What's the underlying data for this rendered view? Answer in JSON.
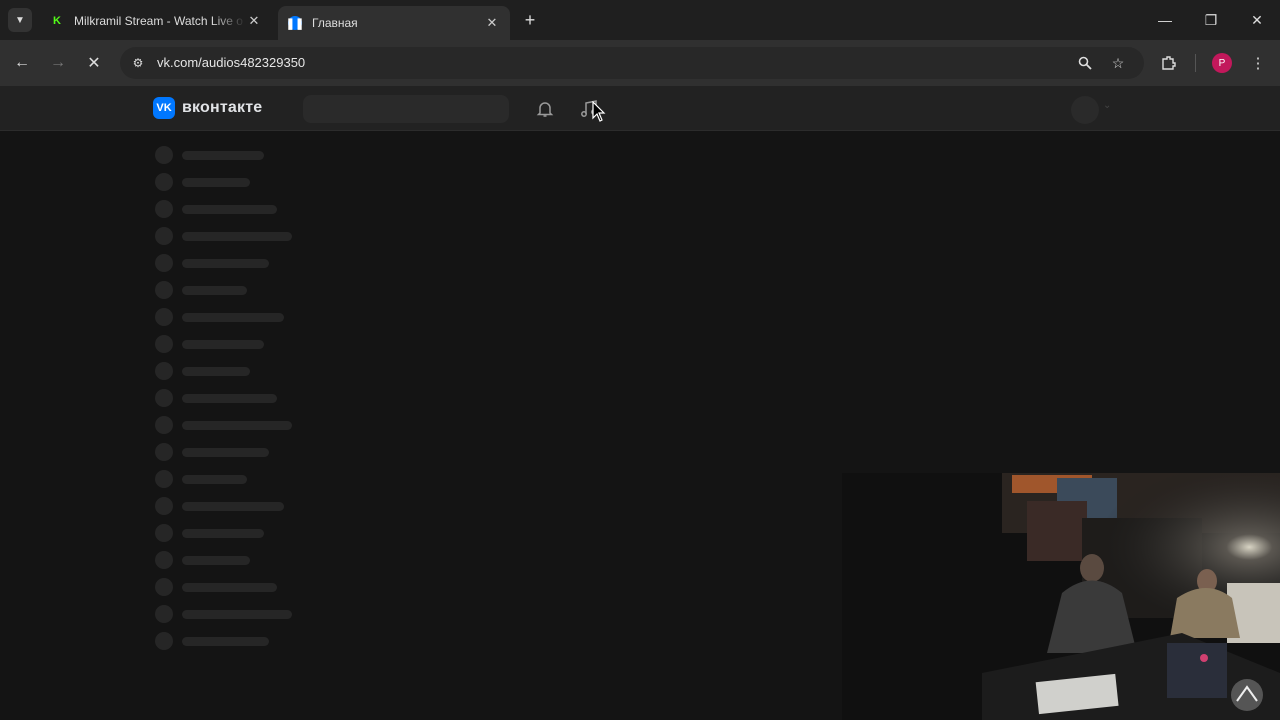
{
  "browser": {
    "tabs": [
      {
        "title": "Milkramil Stream - Watch Live o",
        "favicon": "kick-icon",
        "active": false
      },
      {
        "title": "Главная",
        "favicon": "vk-icon",
        "active": true
      }
    ],
    "address_bar": {
      "url": "vk.com/audios482329350"
    },
    "profile_initial": "P",
    "loading": true
  },
  "vk": {
    "brand": "вконтакте",
    "logo_glyph": "VK",
    "search": {
      "placeholder": ""
    },
    "header_icons": [
      "bell-icon",
      "music-icon"
    ],
    "content_state": "loading-skeleton",
    "skeleton_rows": 19
  },
  "overlay": {
    "type": "webcam-feed"
  },
  "colors": {
    "page_bg": "#141414",
    "header_bg": "#222222",
    "skeleton": "#262626",
    "vk_blue": "#0077ff",
    "profile": "#c2185b",
    "kick_green": "#53fc18"
  }
}
